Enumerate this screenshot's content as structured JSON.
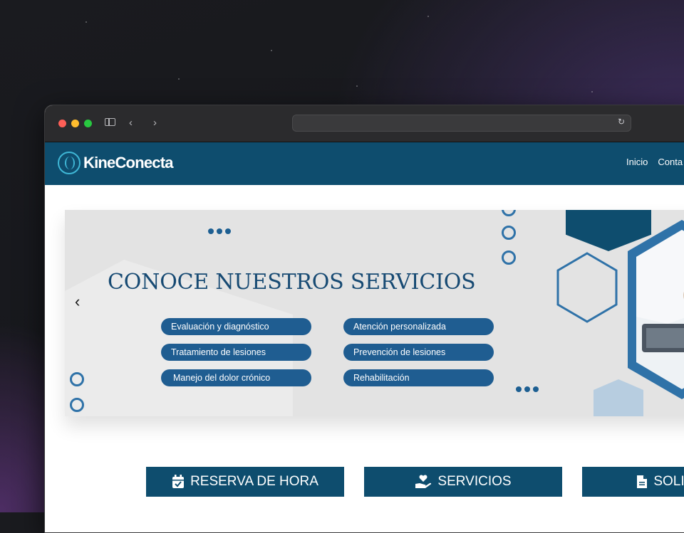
{
  "browser": {
    "url": ""
  },
  "site": {
    "brand": "KineConecta",
    "nav": [
      {
        "label": "Inicio"
      },
      {
        "label": "Conta"
      }
    ]
  },
  "hero": {
    "title": "CONOCE NUESTROS SERVICIOS",
    "services_left": [
      "Evaluación y diagnóstico",
      "Tratamiento de lesiones",
      "Manejo del dolor crónico"
    ],
    "services_right": [
      "Atención personalizada",
      "Prevención de lesiones",
      "Rehabilitación"
    ]
  },
  "actions": [
    {
      "label": "RESERVA DE HORA",
      "icon": "calendar-check-icon"
    },
    {
      "label": "SERVICIOS",
      "icon": "hand-heart-icon"
    },
    {
      "label": "SOLICITUD",
      "icon": "document-icon"
    }
  ],
  "colors": {
    "navbar": "#0e4d6e",
    "accent": "#1f5d91",
    "hero_bg": "#e3e3e3"
  }
}
